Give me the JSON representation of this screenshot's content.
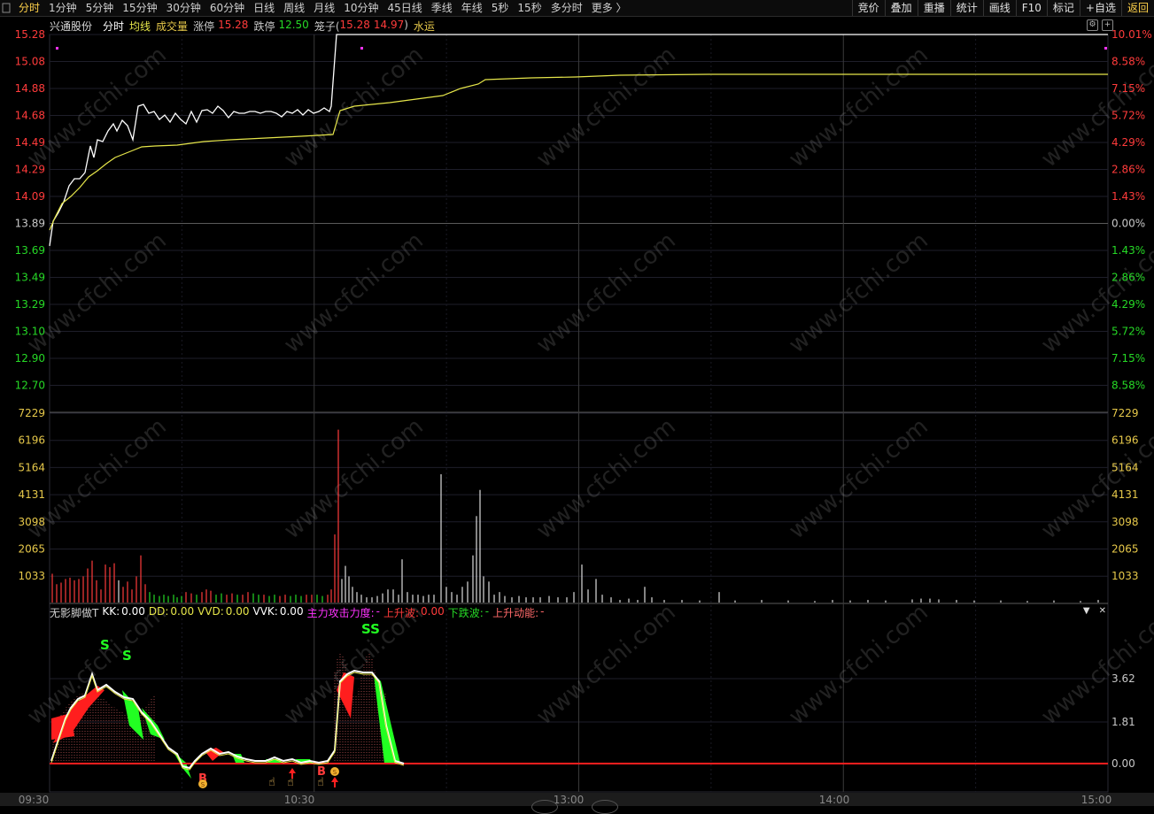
{
  "toolbar": {
    "periods": [
      "分时",
      "1分钟",
      "5分钟",
      "15分钟",
      "30分钟",
      "60分钟",
      "日线",
      "周线",
      "月线",
      "10分钟",
      "45日线",
      "季线",
      "年线",
      "5秒",
      "15秒",
      "多分时",
      "更多 〉"
    ],
    "active": "分时",
    "right_buttons": [
      "竞价",
      "叠加",
      "重播",
      "统计",
      "画线",
      "F10",
      "标记",
      "+自选",
      "返回"
    ]
  },
  "header": {
    "stock_name": "兴通股份",
    "mode": "分时",
    "avg_label": "均线",
    "volume_label": "成交量",
    "limit_up_label": "涨停",
    "limit_up_value": "15.28",
    "limit_down_label": "跌停",
    "limit_down_value": "12.50",
    "cage_label": "笼子(",
    "cage_high": "15.28",
    "cage_low": "14.97",
    "cage_close": ")",
    "water_label": "水运"
  },
  "price_axis": {
    "left": [
      "15.28",
      "15.08",
      "14.88",
      "14.68",
      "14.49",
      "14.29",
      "14.09",
      "13.89",
      "13.69",
      "13.49",
      "13.29",
      "13.10",
      "12.90",
      "12.70"
    ],
    "right": [
      "10.01%",
      "8.58%",
      "7.15%",
      "5.72%",
      "4.29%",
      "2.86%",
      "1.43%",
      "0.00%",
      "1.43%",
      "2.86%",
      "4.29%",
      "5.72%",
      "7.15%",
      "8.58%"
    ]
  },
  "volume_axis": [
    "7229",
    "6196",
    "5164",
    "4131",
    "3098",
    "2065",
    "1033"
  ],
  "indicator": {
    "name": "无影脚做T",
    "kk_label": "KK:",
    "kk_value": "0.00",
    "dd_label": "DD:",
    "dd_value": "0.00",
    "vvd_label": "VVD:",
    "vvd_value": "0.00",
    "vvk_label": "VVK:",
    "vvk_value": "0.00",
    "attack_label": "主力攻击力度:",
    "attack_value": "-",
    "up_wave_label": "上升波:",
    "up_wave_value": "0.00",
    "down_wave_label": "下跌波:",
    "down_wave_value": "-",
    "up_momentum_label": "上升动能:",
    "up_momentum_value": "-",
    "axis": [
      "3.62",
      "1.81",
      "0.00"
    ],
    "signals": [
      "S",
      "S",
      "SS",
      "B",
      "B",
      "S"
    ]
  },
  "time_axis": [
    "09:30",
    "10:30",
    "13:00",
    "14:00",
    "15:00"
  ],
  "watermark": "www.cfchi.com",
  "colors": {
    "up": "#ff3b3b",
    "down": "#26d926",
    "price_line": "#ffffff",
    "avg_line": "#e6e64a",
    "indicator_name": "#ff33ff",
    "grid": "#1e1e2a"
  },
  "chart_data": {
    "type": "line",
    "series": [
      {
        "name": "分时",
        "values": [
          13.89,
          14.0,
          14.1,
          14.22,
          14.32,
          14.45,
          14.55,
          14.6,
          14.72,
          14.7,
          14.65,
          14.64,
          14.66,
          14.7,
          14.71,
          14.69,
          14.68,
          14.7,
          14.72,
          15.28,
          15.28,
          15.28,
          15.28,
          15.28,
          15.28
        ]
      },
      {
        "name": "均线",
        "values": [
          13.89,
          13.98,
          14.1,
          14.25,
          14.35,
          14.42,
          14.45,
          14.47,
          14.48,
          14.5,
          14.52,
          14.53,
          14.55,
          14.7,
          14.75,
          14.8,
          14.85,
          14.9,
          14.93,
          14.95,
          14.96,
          14.96,
          14.97,
          14.97,
          14.97
        ]
      }
    ]
  }
}
